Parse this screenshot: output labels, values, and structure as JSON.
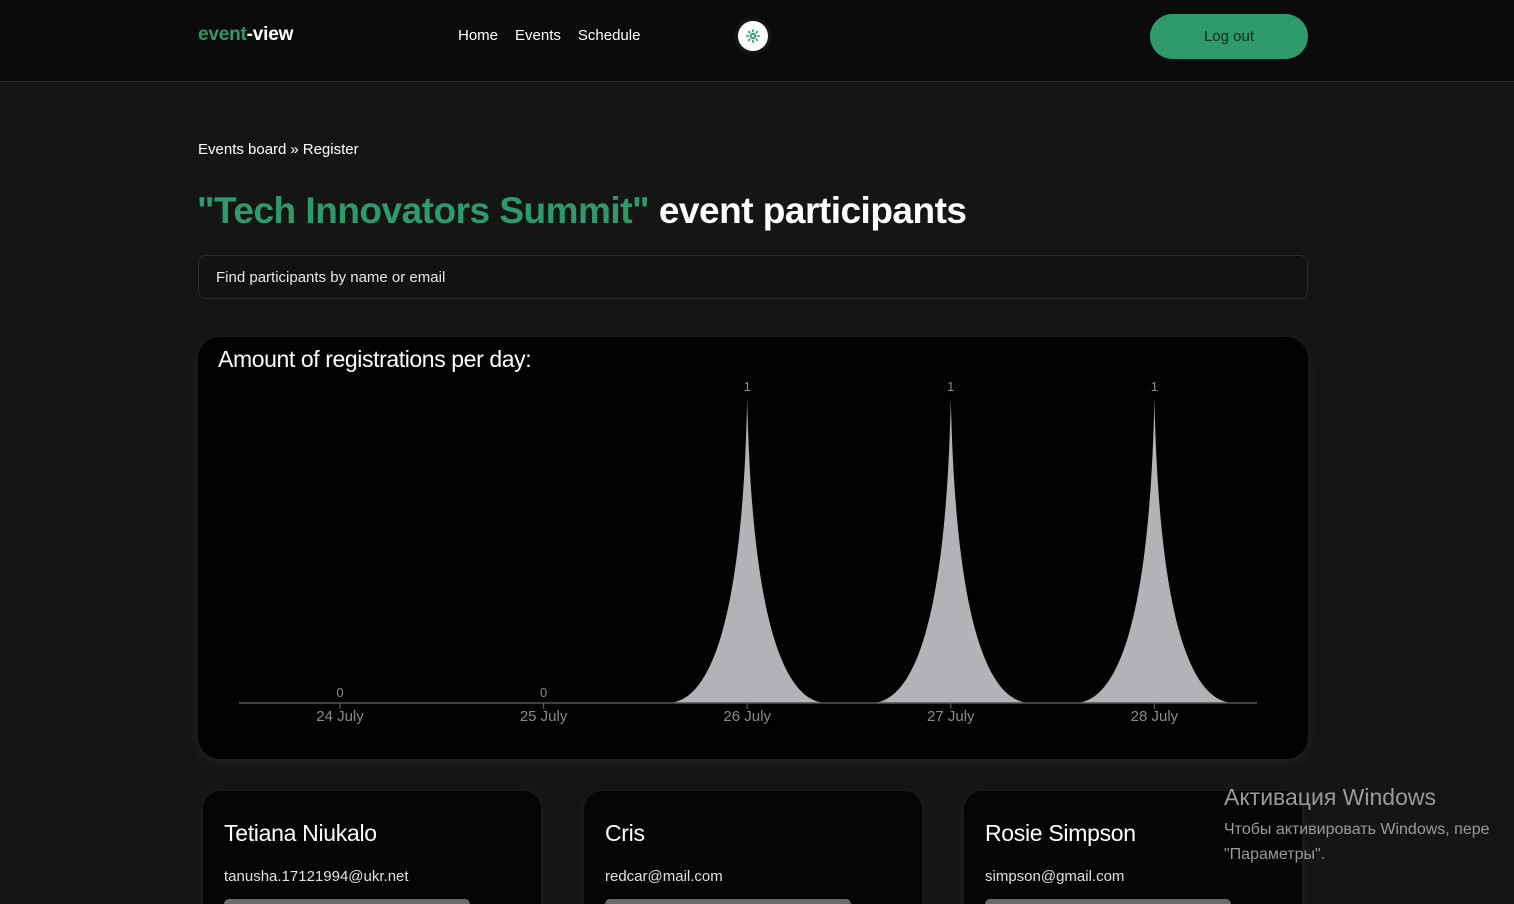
{
  "header": {
    "logo_accent": "event",
    "logo_rest": "-view",
    "nav": [
      "Home",
      "Events",
      "Schedule"
    ],
    "theme_icon": "sun-gear-icon",
    "logout_label": "Log out"
  },
  "breadcrumb": {
    "parent": "Events board",
    "separator": "»",
    "current": "Register"
  },
  "page": {
    "event_name": "\"Tech Innovators Summit\"",
    "title_rest": " event participants"
  },
  "search": {
    "placeholder": "Find participants by name or email",
    "value": ""
  },
  "chart_data": {
    "type": "area",
    "title": "Amount of registrations per day:",
    "categories": [
      "24 July",
      "25 July",
      "26 July",
      "27 July",
      "28 July"
    ],
    "values": [
      0,
      0,
      1,
      1,
      1
    ],
    "ylim": [
      0,
      1
    ]
  },
  "participants": [
    {
      "name": "Tetiana Niukalo",
      "email": "tanusha.17121994@ukr.net"
    },
    {
      "name": "Cris",
      "email": "redcar@mail.com"
    },
    {
      "name": "Rosie Simpson",
      "email": "simpson@gmail.com"
    }
  ],
  "watermark": {
    "title": "Активация Windows",
    "text": "Чтобы активировать Windows, пере\n\"Параметры\"."
  },
  "colors": {
    "accent": "#2e9a6c",
    "background": "#151515",
    "header_bg": "#0b0b0b",
    "chart_fill": "#b3b3b7"
  }
}
